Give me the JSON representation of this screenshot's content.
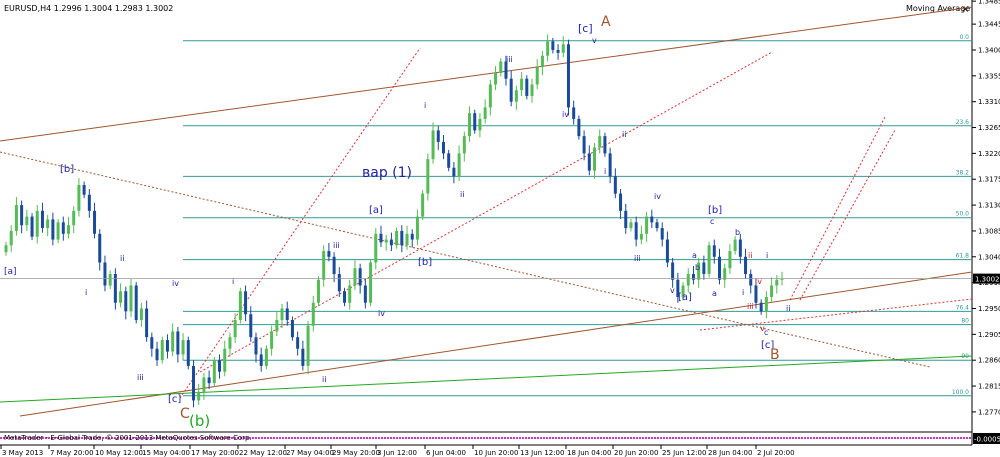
{
  "window": {
    "title": "EURUSD,H4  1.2996 1.3004 1.2983 1.3002",
    "indicator_label": "Moving Average",
    "close_glyph": "×",
    "copyright": "MetaTrader - E-Global Trade, © 2001-2013 MetaQuotes Software Corp.",
    "subwindow_value": "-0.0005"
  },
  "chart_data": {
    "type": "candlestick",
    "symbol": "EURUSD",
    "timeframe": "H4",
    "ohlc": {
      "open": 1.2996,
      "high": 1.3004,
      "low": 1.2983,
      "close": 1.3002
    },
    "current_price_label": "1.3002",
    "ylim": [
      1.2735,
      1.3487
    ],
    "y_ticks": [
      "1.3485",
      "1.3445",
      "1.3400",
      "1.3355",
      "1.3310",
      "1.3265",
      "1.3220",
      "1.3175",
      "1.3130",
      "1.3085",
      "1.3040",
      "1.2995",
      "1.2950",
      "1.2905",
      "1.2860",
      "1.2815",
      "1.2770"
    ],
    "x_ticks": [
      "3 May 2013",
      "7 May 20:00",
      "10 May 12:00",
      "15 May 04:00",
      "17 May 20:00",
      "22 May 12:00",
      "27 May 04:00",
      "29 May 20:00",
      "3 Jun 12:00",
      "6 Jun 04:00",
      "10 Jun 20:00",
      "13 Jun 12:00",
      "18 Jun 04:00",
      "20 Jun 20:00",
      "25 Jun 12:00",
      "28 Jun 04:00",
      "2 Jul 20:00"
    ],
    "fibonacci": {
      "levels": [
        {
          "label": "0.0",
          "price": 1.3416
        },
        {
          "label": "23.6",
          "price": 1.3268
        },
        {
          "label": "38.2",
          "price": 1.318
        },
        {
          "label": "50.0",
          "price": 1.3108
        },
        {
          "label": "61.8",
          "price": 1.3035
        },
        {
          "label": "76.4",
          "price": 1.2945
        },
        {
          "label": "80",
          "price": 1.2922
        },
        {
          "label": "90",
          "price": 1.286
        },
        {
          "label": "100.0",
          "price": 1.2798
        }
      ]
    },
    "series": [
      {
        "values": [
          1.306,
          1.3085,
          1.313,
          1.3095,
          1.311,
          1.3075,
          1.312,
          1.309,
          1.3105,
          1.307,
          1.31,
          1.308,
          1.3095,
          1.312,
          1.3165,
          1.3148,
          1.312,
          1.308,
          1.303,
          1.299,
          1.301,
          1.296,
          1.298,
          1.2945,
          1.299,
          1.293,
          1.295,
          1.29,
          1.288,
          1.286,
          1.2895,
          1.2875,
          1.291,
          1.287,
          1.2895,
          1.285,
          1.279,
          1.2805,
          1.283,
          1.282,
          1.286,
          1.284,
          1.288,
          1.29,
          1.293,
          1.298,
          1.294,
          1.29,
          1.287,
          1.285,
          1.288,
          1.291,
          1.293,
          1.295,
          1.293,
          1.29,
          1.288,
          1.285,
          1.292,
          1.296,
          1.3,
          1.305,
          1.304,
          1.301,
          1.298,
          1.296,
          1.299,
          1.302,
          1.299,
          1.296,
          1.303,
          1.308,
          1.3065,
          1.307,
          1.306,
          1.3085,
          1.306,
          1.308,
          1.307,
          1.311,
          1.315,
          1.321,
          1.326,
          1.324,
          1.322,
          1.3195,
          1.318,
          1.322,
          1.325,
          1.329,
          1.326,
          1.328,
          1.33,
          1.334,
          1.336,
          1.338,
          1.335,
          1.331,
          1.333,
          1.335,
          1.332,
          1.334,
          1.337,
          1.339,
          1.3415,
          1.34,
          1.3395,
          1.341,
          1.33,
          1.328,
          1.325,
          1.322,
          1.319,
          1.323,
          1.325,
          1.322,
          1.318,
          1.315,
          1.312,
          1.309,
          1.31,
          1.307,
          1.308,
          1.311,
          1.31,
          1.309,
          1.307,
          1.303,
          1.3,
          1.297,
          1.299,
          1.301,
          1.3,
          1.303,
          1.301,
          1.306,
          1.304,
          1.3,
          1.302,
          1.305,
          1.307,
          1.304,
          1.301,
          1.299,
          1.296,
          1.2945,
          1.297,
          1.299,
          1.3,
          1.3002
        ]
      }
    ],
    "wave_labels": [
      {
        "text": "[a]"
      },
      {
        "text": "[b]"
      },
      {
        "text": "ii"
      },
      {
        "text": "i"
      },
      {
        "text": "iii"
      },
      {
        "text": "iv"
      },
      {
        "text": "[c]"
      },
      {
        "text": "C"
      },
      {
        "text": "(b)"
      },
      {
        "text": "i"
      },
      {
        "text": "ii"
      },
      {
        "text": "iii"
      },
      {
        "text": "iv"
      },
      {
        "text": "[a]"
      },
      {
        "text": "[b]"
      },
      {
        "text": "вар (1)"
      },
      {
        "text": "i"
      },
      {
        "text": "ii"
      },
      {
        "text": "iii"
      },
      {
        "text": "iv"
      },
      {
        "text": "[c]"
      },
      {
        "text": "v"
      },
      {
        "text": "A"
      },
      {
        "text": "i"
      },
      {
        "text": "ii"
      },
      {
        "text": "iii"
      },
      {
        "text": "iv"
      },
      {
        "text": "v"
      },
      {
        "text": "[a]"
      },
      {
        "text": "a"
      },
      {
        "text": "b"
      },
      {
        "text": "c"
      },
      {
        "text": "[b]"
      },
      {
        "text": "b"
      },
      {
        "text": "a"
      },
      {
        "text": "i"
      },
      {
        "text": "ii"
      },
      {
        "text": "iii"
      },
      {
        "text": "iv"
      },
      {
        "text": "v"
      },
      {
        "text": "c"
      },
      {
        "text": "[c]"
      },
      {
        "text": "B"
      },
      {
        "text": "i"
      },
      {
        "text": "ii"
      }
    ],
    "colors": {
      "bull": "#55bb55",
      "bear": "#1a4a9a",
      "fib": "#339999",
      "channel": "#a05530",
      "dotted": "#dd3333",
      "green_line": "#22aa22",
      "wave_label": "#2222aa",
      "wave_label_red": "#cc2222",
      "major_label": "#a05530"
    }
  }
}
